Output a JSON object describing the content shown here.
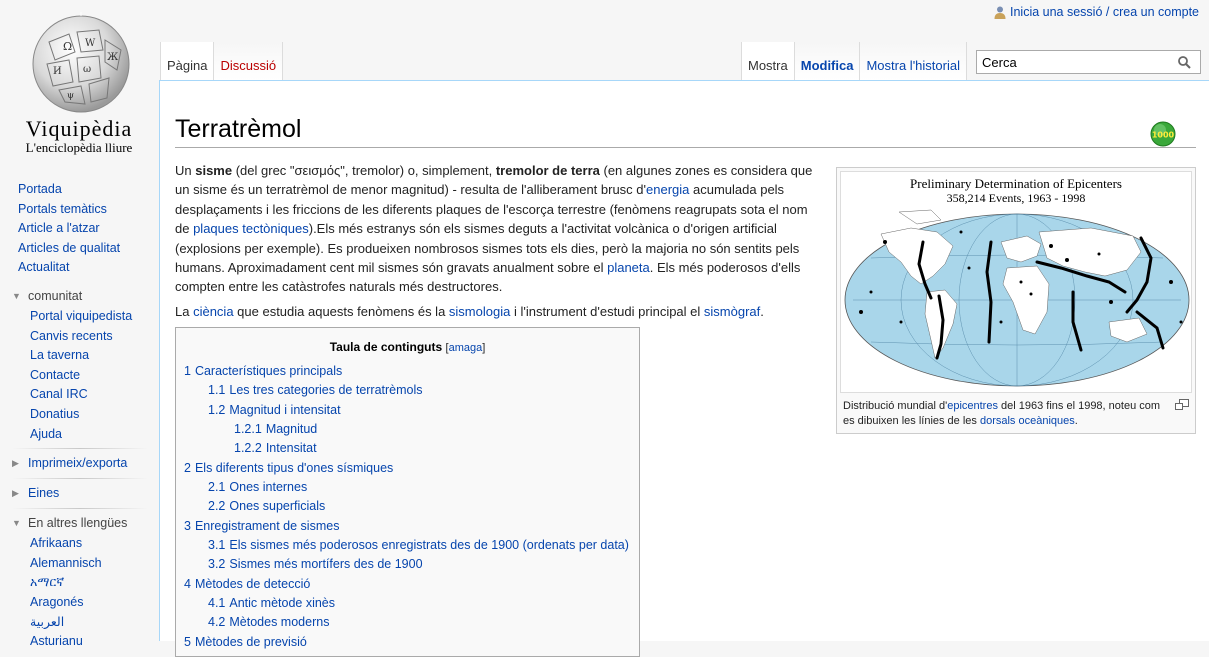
{
  "logo": {
    "wordmark": "Viquipèdia",
    "tagline": "L'enciclopèdia lliure"
  },
  "personal": {
    "login_link": "Inicia una sessió / crea un compte"
  },
  "tabs": {
    "left": [
      {
        "label": "Pàgina"
      },
      {
        "label": "Discussió"
      }
    ],
    "right": [
      {
        "label": "Mostra"
      },
      {
        "label": "Modifica"
      },
      {
        "label": "Mostra l'historial"
      }
    ]
  },
  "search": {
    "placeholder": "Cerca"
  },
  "sidebar": {
    "nav": [
      "Portada",
      "Portals temàtics",
      "Article a l'atzar",
      "Articles de qualitat",
      "Actualitat"
    ],
    "community_heading": "comunitat",
    "community": [
      "Portal viquipedista",
      "Canvis recents",
      "La taverna",
      "Contacte",
      "Canal IRC",
      "Donatius",
      "Ajuda"
    ],
    "print_heading": "Imprimeix/exporta",
    "tools_heading": "Eines",
    "languages_heading": "En altres llengües",
    "languages": [
      "Afrikaans",
      "Alemannisch",
      "አማርኛ",
      "Aragonés",
      "العربية",
      "Asturianu"
    ]
  },
  "article": {
    "title": "Terratrèmol",
    "badge": "1000",
    "p1": {
      "t1": "Un ",
      "b1": "sisme",
      "t2": " (del grec \"σεισμός\", tremolor) o, simplement, ",
      "b2": "tremolor de terra",
      "t3": " (en algunes zones es considera que un sisme és un terratrèmol de menor magnitud) - resulta de l'alliberament brusc d'",
      "l1": "energia",
      "t4": " acumulada pels desplaçaments i les friccions de les diferents plaques de l'escorça terrestre (fenòmens reagrupats sota el nom de ",
      "l2": "plaques tectòniques",
      "t5": ").Els més estranys són els sismes deguts a l'activitat volcànica o d'origen artificial (explosions per exemple). Es produeixen nombrosos sismes tots els dies, però la majoria no són sentits pels humans. Aproximadament cent mil sismes són gravats anualment sobre el ",
      "l3": "planeta",
      "t6": ". Els més poderosos d'ells compten entre les catàstrofes naturals més destructores."
    },
    "p2": {
      "t1": "La ",
      "l1": "ciència",
      "t2": " que estudia aquests fenòmens és la ",
      "l2": "sismologia",
      "t3": " i l'instrument d'estudi principal el ",
      "l3": "sismògraf",
      "t4": "."
    }
  },
  "thumb": {
    "map_title_1": "Preliminary Determination of Epicenters",
    "map_title_2": "358,214 Events, 1963 - 1998",
    "caption": {
      "t1": "Distribució mundial d'",
      "l1": "epicentres",
      "t2": " del 1963 fins el 1998, noteu com es dibuixen les línies de les ",
      "l2": "dorsals oceàniques",
      "t3": "."
    }
  },
  "toc": {
    "title": "Taula de continguts",
    "toggle_open": "[",
    "toggle_label": "amaga",
    "toggle_close": "]",
    "items": [
      {
        "num": "1",
        "text": "Característiques principals"
      },
      {
        "num": "1.1",
        "text": "Les tres categories de terratrèmols"
      },
      {
        "num": "1.2",
        "text": "Magnitud i intensitat"
      },
      {
        "num": "1.2.1",
        "text": "Magnitud"
      },
      {
        "num": "1.2.2",
        "text": "Intensitat"
      },
      {
        "num": "2",
        "text": "Els diferents tipus d'ones sísmiques"
      },
      {
        "num": "2.1",
        "text": "Ones internes"
      },
      {
        "num": "2.2",
        "text": "Ones superficials"
      },
      {
        "num": "3",
        "text": "Enregistrament de sismes"
      },
      {
        "num": "3.1",
        "text": "Els sismes més poderosos enregistrats des de 1900 (ordenats per data)"
      },
      {
        "num": "3.2",
        "text": "Sismes més mortífers des de 1900"
      },
      {
        "num": "4",
        "text": "Mètodes de detecció"
      },
      {
        "num": "4.1",
        "text": "Antic mètode xinès"
      },
      {
        "num": "4.2",
        "text": "Mètodes moderns"
      },
      {
        "num": "5",
        "text": "Mètodes de previsió"
      }
    ]
  },
  "colors": {
    "link": "#0645ad",
    "new_link": "#ba0000",
    "border_blue": "#a7d7f9",
    "ocean": "#a9d6ea"
  }
}
